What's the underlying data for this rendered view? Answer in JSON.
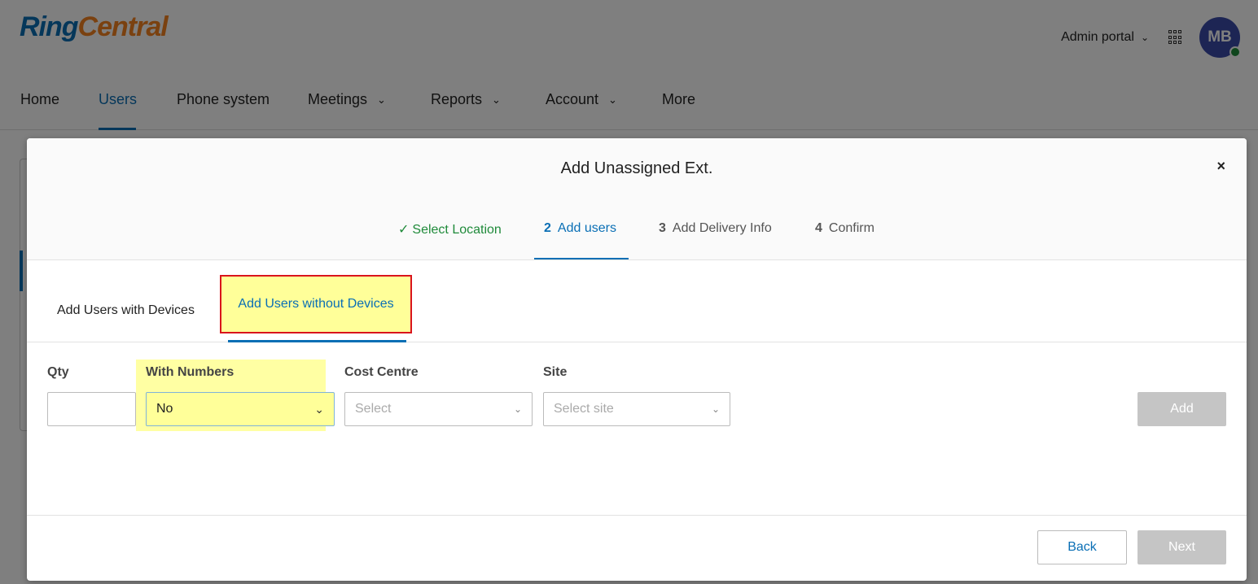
{
  "brand": {
    "part1": "Ring",
    "part2": "Central",
    "colors": {
      "primary": "#0a6fb5",
      "accent": "#f58220"
    }
  },
  "header": {
    "portal_label": "Admin portal",
    "avatar_initials": "MB",
    "apps_icon": "grid-icon"
  },
  "nav": [
    {
      "label": "Home"
    },
    {
      "label": "Users"
    },
    {
      "label": "Phone system"
    },
    {
      "label": "Meetings"
    },
    {
      "label": "Reports"
    },
    {
      "label": "Account"
    },
    {
      "label": "More"
    }
  ],
  "nav_active": "Users",
  "modal": {
    "title": "Add Unassigned Ext.",
    "close_icon": "×",
    "steps": [
      {
        "num": "",
        "label": "Select Location",
        "status": "done"
      },
      {
        "num": "2",
        "label": "Add users",
        "status": "active"
      },
      {
        "num": "3",
        "label": "Add Delivery Info",
        "status": "pending"
      },
      {
        "num": "4",
        "label": "Confirm",
        "status": "pending"
      }
    ],
    "tabs": [
      {
        "label": "Add Users with Devices"
      },
      {
        "label": "Add Users without Devices"
      }
    ],
    "active_tab": "Add Users without Devices",
    "form": {
      "qty": {
        "label": "Qty",
        "value": ""
      },
      "numbers": {
        "label": "With Numbers",
        "value": "No"
      },
      "cost_centre": {
        "label": "Cost Centre",
        "placeholder": "Select"
      },
      "site": {
        "label": "Site",
        "placeholder": "Select site"
      },
      "add_label": "Add"
    },
    "footer": {
      "back_label": "Back",
      "next_label": "Next"
    }
  }
}
